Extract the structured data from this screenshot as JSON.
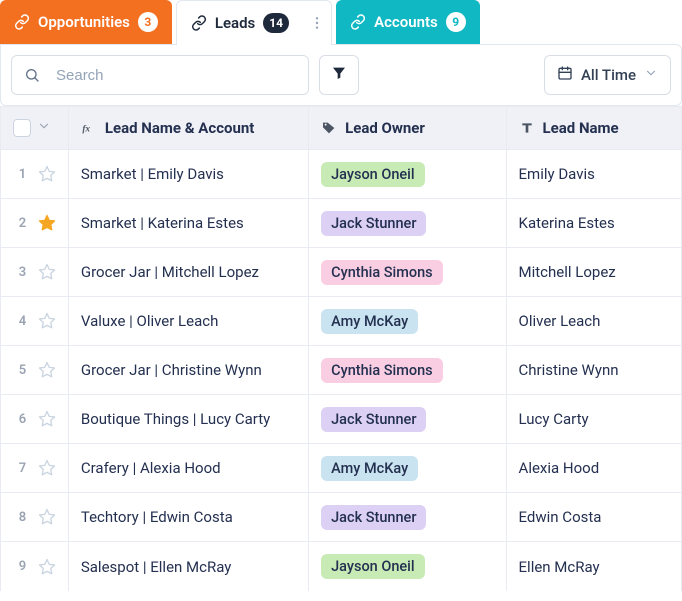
{
  "tabs": {
    "opportunities": {
      "label": "Opportunities",
      "count": "3"
    },
    "leads": {
      "label": "Leads",
      "count": "14"
    },
    "accounts": {
      "label": "Accounts",
      "count": "9"
    }
  },
  "toolbar": {
    "search_placeholder": "Search",
    "time_label": "All Time"
  },
  "columns": {
    "fx": "Lead Name & Account",
    "owner": "Lead Owner",
    "name": "Lead Name"
  },
  "owner_colors": {
    "Jayson Oneil": "green",
    "Jack Stunner": "purple",
    "Cynthia Simons": "pink",
    "Amy McKay": "blue"
  },
  "rows": [
    {
      "n": "1",
      "star": false,
      "fx": "Smarket | Emily Davis",
      "owner": "Jayson Oneil",
      "name": "Emily Davis"
    },
    {
      "n": "2",
      "star": true,
      "fx": "Smarket | Katerina Estes",
      "owner": "Jack Stunner",
      "name": "Katerina Estes"
    },
    {
      "n": "3",
      "star": false,
      "fx": "Grocer Jar | Mitchell Lopez",
      "owner": "Cynthia Simons",
      "name": "Mitchell Lopez"
    },
    {
      "n": "4",
      "star": false,
      "fx": "Valuxe | Oliver Leach",
      "owner": "Amy McKay",
      "name": "Oliver Leach"
    },
    {
      "n": "5",
      "star": false,
      "fx": "Grocer Jar | Christine Wynn",
      "owner": "Cynthia Simons",
      "name": "Christine Wynn"
    },
    {
      "n": "6",
      "star": false,
      "fx": "Boutique Things | Lucy Carty",
      "owner": "Jack Stunner",
      "name": "Lucy Carty"
    },
    {
      "n": "7",
      "star": false,
      "fx": "Crafery | Alexia Hood",
      "owner": "Amy McKay",
      "name": "Alexia Hood"
    },
    {
      "n": "8",
      "star": false,
      "fx": "Techtory | Edwin Costa",
      "owner": "Jack Stunner",
      "name": "Edwin Costa"
    },
    {
      "n": "9",
      "star": false,
      "fx": "Salespot | Ellen McRay",
      "owner": "Jayson Oneil",
      "name": "Ellen McRay"
    }
  ]
}
